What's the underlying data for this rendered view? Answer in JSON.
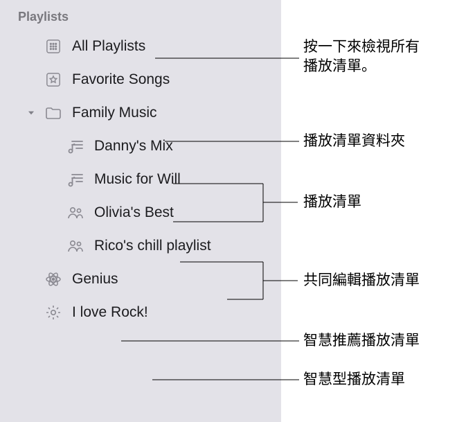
{
  "sidebar": {
    "section_header": "Playlists",
    "items": [
      {
        "icon": "grid-icon",
        "label": "All Playlists"
      },
      {
        "icon": "star-icon",
        "label": "Favorite Songs"
      },
      {
        "icon": "folder-icon",
        "label": "Family Music",
        "expanded": true
      },
      {
        "icon": "playlist-icon",
        "label": "Danny's Mix",
        "nested": true
      },
      {
        "icon": "playlist-icon",
        "label": "Music for Will",
        "nested": true
      },
      {
        "icon": "people-icon",
        "label": "Olivia's Best",
        "nested": true
      },
      {
        "icon": "people-icon",
        "label": "Rico's chill playlist",
        "nested": true
      },
      {
        "icon": "atom-icon",
        "label": "Genius"
      },
      {
        "icon": "gear-icon",
        "label": "I love Rock!"
      }
    ]
  },
  "annotations": {
    "a0": "按一下來檢視所有\n播放清單。",
    "a1": "播放清單資料夾",
    "a2": "播放清單",
    "a3": "共同編輯播放清單",
    "a4": "智慧推薦播放清單",
    "a5": "智慧型播放清單"
  }
}
